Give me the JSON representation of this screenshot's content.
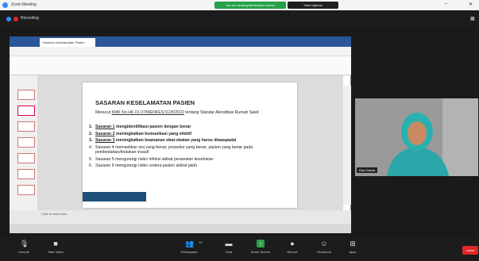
{
  "window": {
    "app_title": "Zoom Meeting"
  },
  "banner": {
    "share_text": "You are viewing Marlinaka's screen",
    "view_options": "View Options"
  },
  "zoombar": {
    "recording": "Recording"
  },
  "ppt": {
    "file_tab": "Sasaran Keselamatan Pasien",
    "add_notes": "Click to add notes"
  },
  "slide": {
    "title": "SASARAN KESELAMATAN PASIEN",
    "intro_pre": "Menurut ",
    "intro_link": "KMK No.HK.01.07/MENKES/1128/2022",
    "intro_post": " tentang Standar Akreditasi Rumah Sakit:",
    "items": [
      {
        "num": "1.",
        "lead": "Sasaran 1",
        "text": " mengidentifikasi pasien dengan benar",
        "bold": true
      },
      {
        "num": "2.",
        "lead": "Sasaran 2",
        "text": " meningkatkan komunikasi yang efektif",
        "bold": true
      },
      {
        "num": "3.",
        "lead": "Sasaran 3",
        "text": " meningkatkan keamanan obat-obatan yang harus diwaspadai",
        "bold": true
      },
      {
        "num": "4.",
        "lead": "Sasaran 4",
        "text": " memastikan sisi yang benar, prosedur yang benar, pasien yang benar pada pembedahan/tindakan invasif",
        "bold": false
      },
      {
        "num": "5.",
        "lead": "Sasaran 5",
        "text": " mengurangi risiko infeksi akibat perawatan kesehatan",
        "bold": false
      },
      {
        "num": "6.",
        "lead": "Sasaran 6",
        "text": " mengurangi risiko cedera pasien akibat jatuh",
        "bold": false
      }
    ]
  },
  "video": {
    "participant": "Elya Dwida"
  },
  "toolbar": {
    "unmute": "Unmute",
    "start_video": "Start Video",
    "participants": "Participants",
    "participants_count": "12",
    "chat": "Chat",
    "share_screen": "Share Screen",
    "record": "Record",
    "reactions": "Reactions",
    "apps": "Apps",
    "end": "Leave"
  },
  "colors": {
    "zoom_blue": "#2d8cff",
    "share_green": "#26a148",
    "end_red": "#e02828",
    "ppt_blue": "#2b579a",
    "slide_footer": "#1f4e79"
  }
}
